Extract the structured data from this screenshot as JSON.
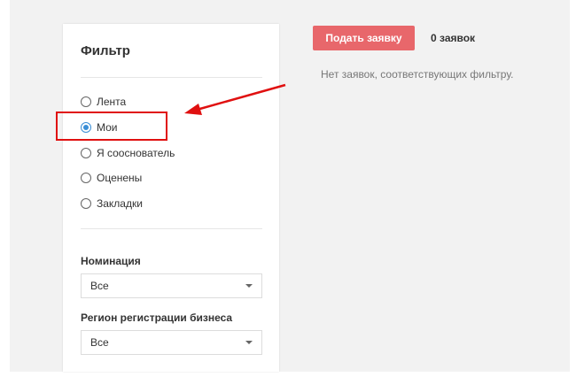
{
  "filter": {
    "title": "Фильтр",
    "options": [
      {
        "label": "Лента",
        "checked": false
      },
      {
        "label": "Мои",
        "checked": true
      },
      {
        "label": "Я сооснователь",
        "checked": false
      },
      {
        "label": "Оценены",
        "checked": false
      },
      {
        "label": "Закладки",
        "checked": false
      }
    ],
    "nomination": {
      "label": "Номинация",
      "value": "Все"
    },
    "region": {
      "label": "Регион регистрации бизнеса",
      "value": "Все"
    }
  },
  "main": {
    "submit_label": "Подать заявку",
    "count_text": "0 заявок",
    "empty_message": "Нет заявок, соответствующих фильтру."
  },
  "colors": {
    "accent": "#e8676b",
    "radio_checked": "#3a8ed6",
    "annotation": "#e01010"
  }
}
